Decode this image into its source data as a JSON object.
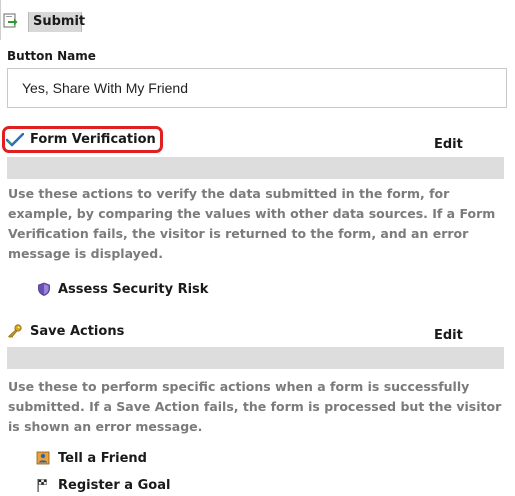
{
  "submit": {
    "label": "Submit"
  },
  "button_name": {
    "label": "Button Name",
    "value": "Yes, Share With My Friend"
  },
  "form_verification": {
    "title": "Form Verification",
    "edit_label": "Edit",
    "description": "Use these actions to verify the data submitted in the form, for example, by comparing the values with other data sources. If a Form Verification fails, the visitor is returned to the form, and an error message is displayed.",
    "items": [
      {
        "label": "Assess Security Risk",
        "icon": "shield-icon"
      }
    ]
  },
  "save_actions": {
    "title": "Save Actions",
    "edit_label": "Edit",
    "description": "Use these to perform specific actions when a form is successfully submitted. If a Save Action fails, the form is processed but the visitor is shown an error message.",
    "items": [
      {
        "label": "Tell a Friend",
        "icon": "contact-card-icon"
      },
      {
        "label": "Register a Goal",
        "icon": "flag-icon"
      }
    ]
  },
  "colors": {
    "highlight_ring": "#e02020",
    "bar_grey": "#dddddd",
    "description_text": "#7b7b7b"
  }
}
